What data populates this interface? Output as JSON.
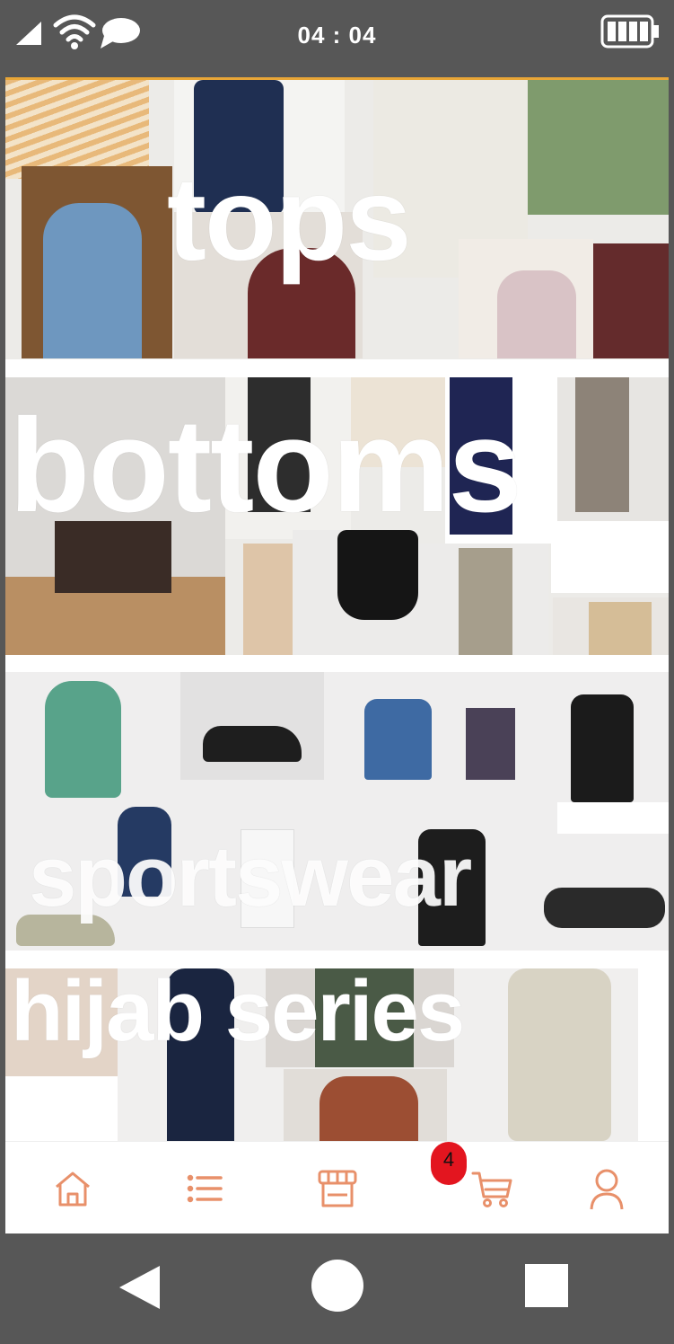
{
  "status_bar": {
    "time": "04 : 04",
    "icons": [
      "signal-icon",
      "wifi-icon",
      "message-icon",
      "battery-icon"
    ]
  },
  "banners": [
    {
      "title": "tops"
    },
    {
      "title": "bottoms"
    },
    {
      "title": "sportswear"
    },
    {
      "title": "hijab series"
    }
  ],
  "bottom_nav": {
    "items": [
      "home-icon",
      "list-icon",
      "store-icon",
      "cart-icon",
      "profile-icon"
    ],
    "cart_badge": "4",
    "icon_color": "#e8906a"
  },
  "system_nav": [
    "back-icon",
    "home-circle-icon",
    "recents-icon"
  ],
  "colors": {
    "accent": "#e8a637",
    "badge": "#e3151f",
    "chrome": "#575757"
  }
}
